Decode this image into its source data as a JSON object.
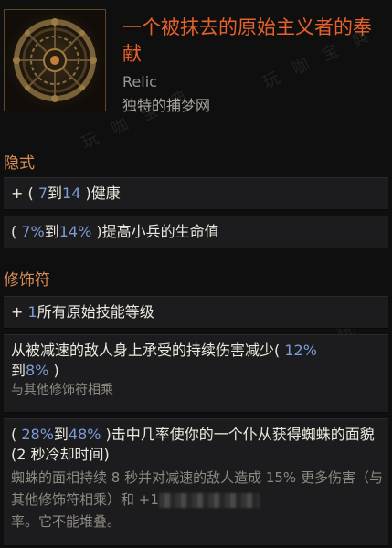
{
  "item": {
    "name": "一个被抹去的原始主义者的奉献",
    "base_type": "Relic",
    "subtitle": "独特的捕梦网"
  },
  "sections": {
    "implicit_title": "隐式",
    "modifier_title": "修饰符"
  },
  "mods": {
    "m1": {
      "prefix": "+ ( ",
      "v1": "7",
      "to": "到",
      "v2": "14",
      "suffix": " )健康"
    },
    "m2": {
      "prefix": "( ",
      "v1": "7%",
      "to": "到",
      "v2": "14%",
      "suffix": " )提高小兵的生命值"
    },
    "m3": {
      "prefix": "+ ",
      "v1": "1",
      "suffix": "所有原始技能等级"
    },
    "m4": {
      "text": "从被减速的敌人身上承受的持续伤害减少( ",
      "v1": "12%",
      "to": "到",
      "v2": "8%",
      "close": " )",
      "note": "与其他修饰符相乘"
    },
    "m5": {
      "prefix": "( ",
      "v1": "28%",
      "to": "到",
      "v2": "48%",
      "suffix": " )击中几率使你的一个仆从获得蜘蛛的面貌  (2 秒冷却时间)",
      "note": "蜘蛛的面相持续 8 秒并对减速的敌人造成 15% 更多伤害（与其他修饰符相乘）和 +1",
      "note_end": "率。它不能堆叠。"
    }
  },
  "watermark": {
    "text": "玩 咖 宝 典"
  },
  "colors": {
    "name": "#e8612c",
    "section": "#d88c55",
    "value": "#7d9bd6"
  },
  "icon": "dreamcatcher-relic-icon"
}
